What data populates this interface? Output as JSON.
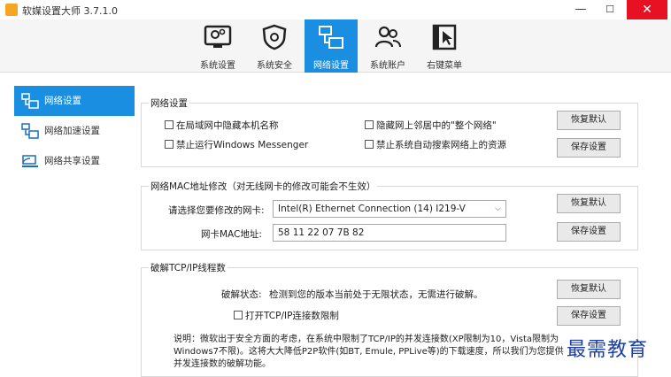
{
  "window": {
    "title": "软媒设置大师 3.7.1.0",
    "minimize": "—",
    "maximize": "☐",
    "close": "✕"
  },
  "toolbar": {
    "items": [
      {
        "label": "系统设置",
        "icon": "display-gear-icon"
      },
      {
        "label": "系统安全",
        "icon": "shield-gear-icon"
      },
      {
        "label": "网络设置",
        "icon": "network-computers-icon",
        "active": true
      },
      {
        "label": "系统账户",
        "icon": "users-icon"
      },
      {
        "label": "右键菜单",
        "icon": "cursor-menu-icon"
      }
    ]
  },
  "sidebar": {
    "items": [
      {
        "label": "网络设置",
        "active": true
      },
      {
        "label": "网络加速设置"
      },
      {
        "label": "网络共享设置"
      }
    ]
  },
  "network": {
    "title": "网络设置",
    "options": [
      "在局域网中隐藏本机名称",
      "禁止运行Windows Messenger",
      "隐藏网上邻居中的\"整个网络\"",
      "禁止系统自动搜索网络上的资源"
    ],
    "restore": "恢复默认",
    "save": "保存设置"
  },
  "mac": {
    "title": "网络MAC地址修改（对无线网卡的修改可能会不生效）",
    "select_label": "请选择您要修改的网卡:",
    "adapter": "Intel(R) Ethernet Connection (14) I219-V",
    "mac_label": "网卡MAC地址:",
    "mac_value": "58 11 22 07 7B 82",
    "restore": "恢复默认",
    "save": "保存设置"
  },
  "tcp": {
    "title": "破解TCP/IP线程数",
    "status_label": "破解状态:",
    "status_text": "检测到您的版本当前处于无限状态，无需进行破解。",
    "checkbox": "打开TCP/IP连接数限制",
    "restore": "恢复默认",
    "save": "保存设置",
    "note_lines": [
      "说明：微软出于安全方面的考虑，在系统中限制了TCP/IP的并发连接数(XP限制为10，Vista限制为",
      "Windows7不限)。这将大大降低P2P软件(如BT, Emule, PPLive等)的下载速度，所以我们为您提供",
      "并发连接数的破解功能。"
    ]
  },
  "watermark": "最需教育",
  "colors": {
    "accent": "#1a8ee0",
    "close": "#e81123"
  }
}
